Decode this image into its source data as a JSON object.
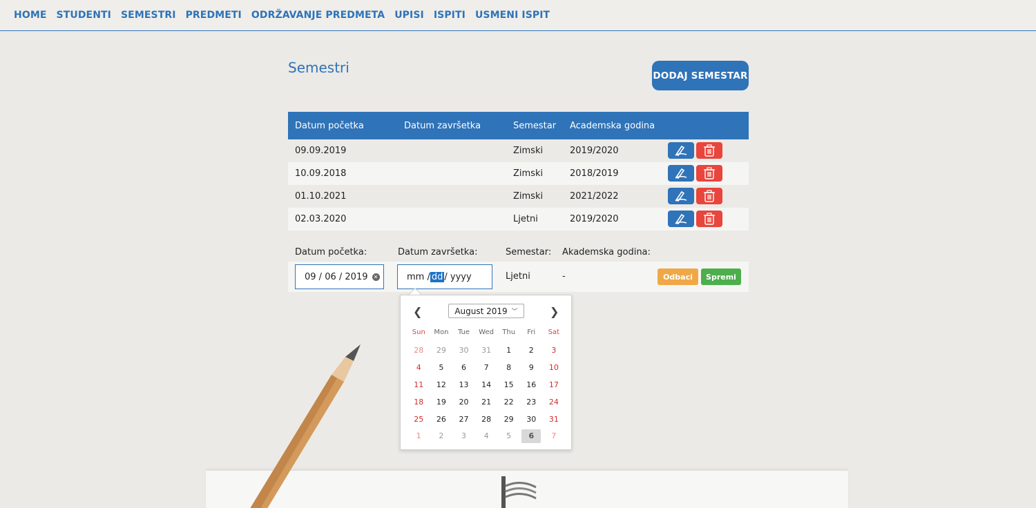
{
  "nav": [
    "HOME",
    "STUDENTI",
    "SEMESTRI",
    "PREDMETI",
    "ODRŽAVANJE PREDMETA",
    "UPISI",
    "ISPITI",
    "USMENI ISPIT"
  ],
  "page": {
    "title": "Semestri",
    "add_button": "DODAJ SEMESTAR"
  },
  "table": {
    "headers": [
      "Datum početka",
      "Datum završetka",
      "Semestar",
      "Academska godina"
    ],
    "rows": [
      {
        "start": "09.09.2019",
        "end": "",
        "semester": "Zimski",
        "year": "2019/2020"
      },
      {
        "start": "10.09.2018",
        "end": "",
        "semester": "Zimski",
        "year": "2018/2019"
      },
      {
        "start": "01.10.2021",
        "end": "",
        "semester": "Zimski",
        "year": "2021/2022"
      },
      {
        "start": "02.03.2020",
        "end": "",
        "semester": "Ljetni",
        "year": "2019/2020"
      }
    ]
  },
  "form": {
    "labels": [
      "Datum početka:",
      "Datum završetka:",
      "Semestar:",
      "Akademska godina:"
    ],
    "start_value": {
      "mm": "09",
      "dd": "06",
      "yyyy": "2019"
    },
    "end_value": {
      "mm": "mm",
      "dd": "dd",
      "yyyy": "yyyy"
    },
    "semester_value": "Ljetni",
    "year_value": "-",
    "cancel_label": "Odbaci",
    "save_label": "Spremi"
  },
  "calendar": {
    "month_label": "August 2019",
    "weekdays": [
      "Sun",
      "Mon",
      "Tue",
      "Wed",
      "Thu",
      "Fri",
      "Sat"
    ],
    "weeks": [
      [
        "28",
        "29",
        "30",
        "31",
        "1",
        "2",
        "3"
      ],
      [
        "4",
        "5",
        "6",
        "7",
        "8",
        "9",
        "10"
      ],
      [
        "11",
        "12",
        "13",
        "14",
        "15",
        "16",
        "17"
      ],
      [
        "18",
        "19",
        "20",
        "21",
        "22",
        "23",
        "24"
      ],
      [
        "25",
        "26",
        "27",
        "28",
        "29",
        "30",
        "31"
      ],
      [
        "1",
        "2",
        "3",
        "4",
        "5",
        "6",
        "7"
      ]
    ],
    "today": "6"
  },
  "colors": {
    "primary": "#2f73b8",
    "danger": "#e8453c",
    "warning": "#f0a847",
    "success": "#4cae4c"
  }
}
